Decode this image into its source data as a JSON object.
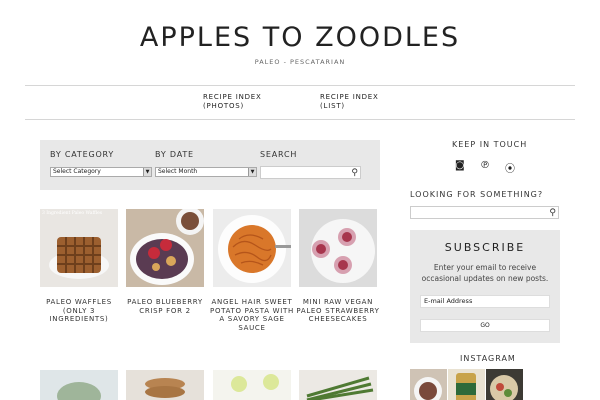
{
  "site": {
    "title": "APPLES TO ZOODLES",
    "tagline": "PALEO - PESCATARIAN"
  },
  "nav": {
    "items": [
      {
        "label": "RECIPE INDEX\n(PHOTOS)"
      },
      {
        "label": "RECIPE INDEX\n(LIST)"
      }
    ]
  },
  "filters": {
    "category_label": "BY CATEGORY",
    "category_value": "Select Category",
    "date_label": "BY DATE",
    "date_value": "Select Month",
    "search_label": "SEARCH",
    "search_placeholder": ""
  },
  "recipes": [
    {
      "caption": "PALEO WAFFLES\n(ONLY 3\nINGREDIENTS)",
      "overlay": "3 Ingredient Paleo Waffles",
      "image": "waffle-photo"
    },
    {
      "caption": "PALEO BLUEBERRY\nCRISP FOR 2",
      "image": "blueberry-crisp-photo"
    },
    {
      "caption": "ANGEL HAIR SWEET\nPOTATO PASTA WITH\nA SAVORY SAGE\nSAUCE",
      "image": "sweet-potato-pasta-photo"
    },
    {
      "caption": "MINI RAW VEGAN\nPALEO STRAWBERRY\nCHEESECAKES",
      "image": "cheesecake-photo"
    }
  ],
  "recipes_row2": [
    {
      "image": "salad-photo"
    },
    {
      "image": "pancake-stack-photo"
    },
    {
      "image": "lemon-drinks-photo"
    },
    {
      "image": "asparagus-photo"
    }
  ],
  "sidebar": {
    "keep_in_touch": "KEEP IN TOUCH",
    "social_icons": [
      "instagram-icon",
      "pinterest-icon",
      "rss-icon"
    ],
    "looking_for": "LOOKING FOR SOMETHING?",
    "search_placeholder": "",
    "subscribe": {
      "title": "SUBSCRIBE",
      "text": "Enter your email to receive occasional updates on new posts.",
      "email_placeholder": "E-mail Address",
      "go_label": "GO"
    },
    "instagram_label": "INSTAGRAM"
  },
  "colors": {
    "panel": "#e8e8e8",
    "text": "#333333",
    "divider": "#d6d6d6"
  }
}
